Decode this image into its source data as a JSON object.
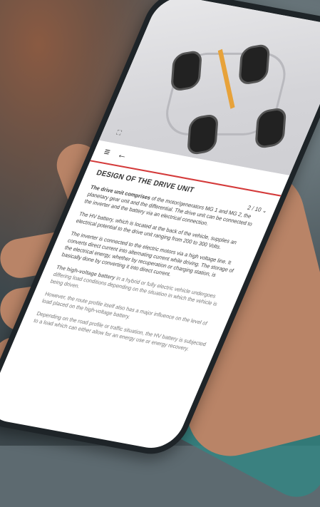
{
  "screen": {
    "title": "DESIGN OF THE DRIVE UNIT",
    "pager": "2 / 10",
    "paragraphs": [
      {
        "bold": "The drive unit comprises",
        "rest": " of the motor/generators MG 1 and MG 2, the planetary gear unit and the differential. The drive unit can be connected to the inverter and the battery via an electrical connection."
      },
      {
        "bold": "",
        "rest": "The HV battery, which is located at the back of the vehicle, supplies an electrical potential to the drive unit ranging from 200 to 300 Volts."
      },
      {
        "bold": "",
        "rest": "The inverter is connected to the electric motors via a high voltage line. It converts direct current into alternating current while driving. The storage of the electrical energy, whether by recuperation or charging station, is basically done by converting it into direct current."
      },
      {
        "bold": "The high-voltage battery",
        "rest": " in a hybrid or fully electric vehicle undergoes differing load conditions depending on the situation in which the vehicle is being driven."
      },
      {
        "bold": "",
        "rest": "However, the route profile itself also has a major influence on the level of load placed on the high-voltage battery."
      },
      {
        "bold": "",
        "rest": "Depending on the road profile or traffic situation, the HV battery is subjected to a load which can either allow for an energy use or energy recovery."
      }
    ]
  },
  "icons": {
    "menu": "menu-icon",
    "back": "back-arrow-icon",
    "fullscreen": "expand-icon",
    "chevron": "chevron-down-icon"
  },
  "colors": {
    "accent": "#d43a3a",
    "axle": "#e7a23a"
  }
}
